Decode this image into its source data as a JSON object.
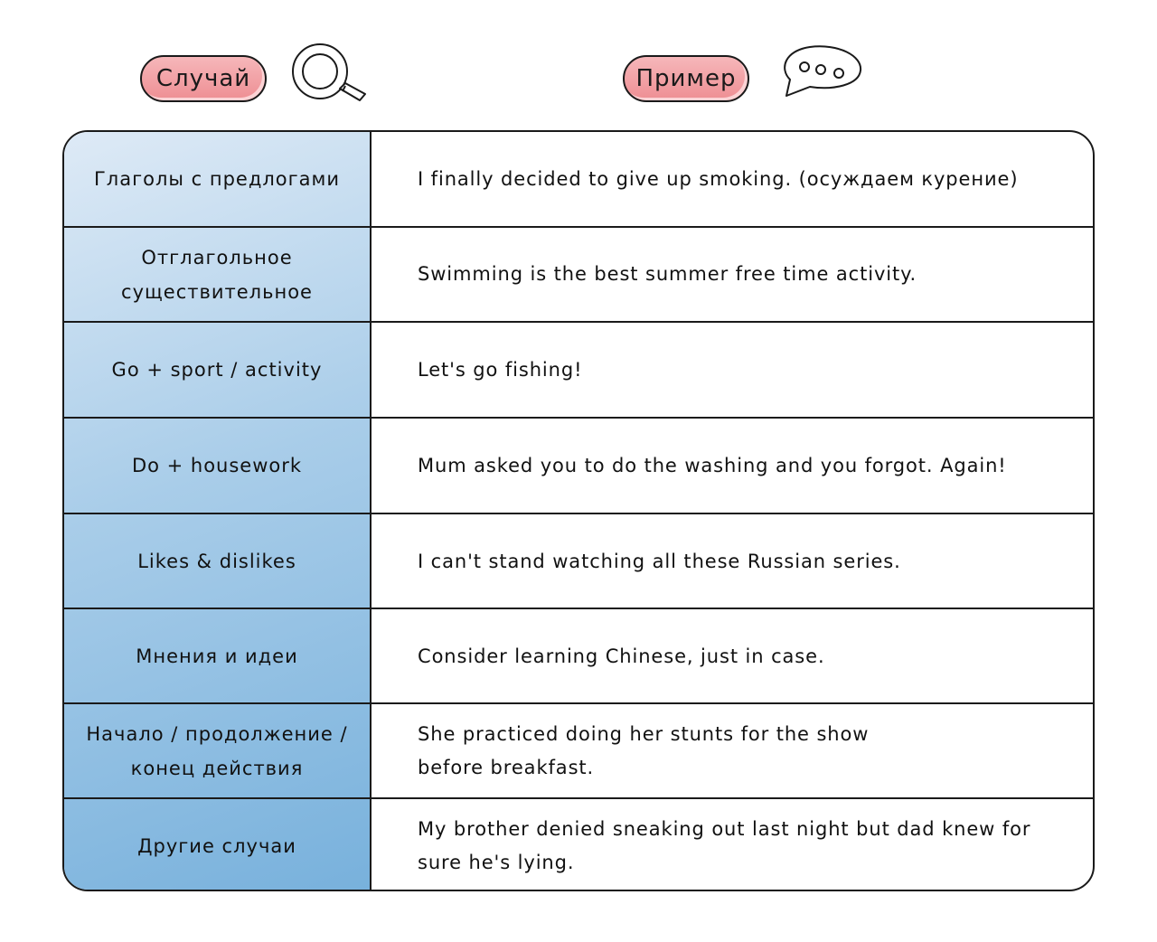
{
  "header": {
    "case_label": "Случай",
    "example_label": "Пример",
    "case_icon": "magnifier-icon",
    "example_icon": "speech-bubble-icon",
    "pill_color": "#f0959a"
  },
  "table": {
    "columns": [
      "Случай",
      "Пример"
    ],
    "rows": [
      {
        "case": "Глаголы с предлогами",
        "example": "I finally decided to give up smoking. (осуждаем курение)"
      },
      {
        "case": "Отглагольное существительное",
        "example": "Swimming is the best summer free time activity."
      },
      {
        "case": "Go + sport / activity",
        "example": "Let's go fishing!"
      },
      {
        "case": "Do + housework",
        "example": "Mum asked you to do the washing and you forgot. Again!"
      },
      {
        "case": "Likes & dislikes",
        "example": "I can't stand watching all these Russian series."
      },
      {
        "case": "Мнения и идеи",
        "example": "Consider learning Chinese, just in case."
      },
      {
        "case": "Начало / продолжение / конец действия",
        "example": "She practiced doing her stunts for the show before breakfast."
      },
      {
        "case": "Другие случаи",
        "example": "My brother denied sneaking out last night but dad knew for sure he's lying."
      }
    ]
  }
}
